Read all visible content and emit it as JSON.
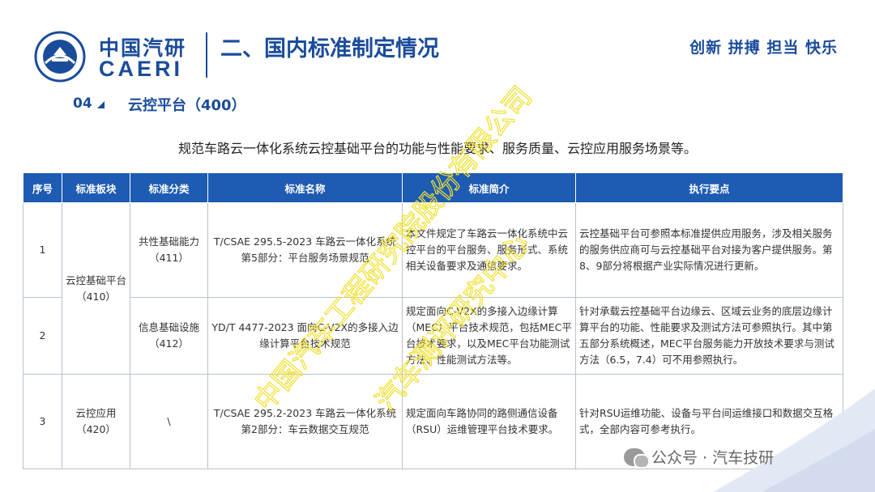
{
  "header": {
    "logo_cn": "中国汽研",
    "logo_en": "CAERI",
    "logo_seal_text": "中国汽车工程研究院",
    "title": "二、国内标准制定情况",
    "slogan": "创新 拼搏 担当 快乐"
  },
  "section": {
    "number": "04",
    "title": "云控平台（400）"
  },
  "intro": "规范车路云一体化系统云控基础平台的功能与性能要求、服务质量、云控应用服务场景等。",
  "table": {
    "headers": [
      "序号",
      "标准板块",
      "标准分类",
      "标准名称",
      "标准简介",
      "执行要点"
    ],
    "rows": [
      {
        "no": "1",
        "block": "云控基础平台（410）",
        "category": "共性基础能力（411）",
        "name": "T/CSAE 295.5-2023 车路云一体化系统 第5部分：平台服务场景规范",
        "intro": "本文件规定了车路云一体化系统中云控平台的平台服务、服务形式、系统相关设备要求及通信要求。",
        "points": "云控基础平台可参照本标准提供应用服务，涉及相关服务的服务供应商可与云控基础平台对接为客户提供服务。第8、9部分将根据产业实际情况进行更新。"
      },
      {
        "no": "2",
        "category": "信息基础设施（412）",
        "name": "YD/T 4477-2023 面向C-V2X的多接入边缘计算平台技术规范",
        "intro": "规定面向C-V2X的多接入边缘计算（MEC）平台技术规范，包括MEC平台技术要求，以及MEC平台功能测试方法、性能测试方法等。",
        "points": "针对承载云控基础平台边缘云、区域云业务的底层边缘计算平台的功能、性能要求及测试方法可参照执行。其中第五部分系统概述，MEC平台服务能力开放技术要求与测试方法（6.5，7.4）可不用参照执行。"
      },
      {
        "no": "3",
        "block": "云控应用（420）",
        "category": "\\",
        "name": "T/CSAE 295.2-2023 车路云一体化系统 第2部分：车云数据交互规范",
        "intro": "规定面向车路协同的路侧通信设备（RSU）运维管理平台技术要求。",
        "points": "针对RSU运维功能、设备与平台间运维接口和数据交互格式，全部内容可参考执行。"
      }
    ]
  },
  "watermark": {
    "line1": "中国汽车工程研究院股份有限公司",
    "line2": "汽车测评研究中心"
  },
  "footer": {
    "wechat": "公众号 · 汽车技研"
  },
  "colors": {
    "brand_blue": "#1b4c9b",
    "header_blue": "#1e5bb3",
    "watermark_yellow": "#f4e53a"
  }
}
